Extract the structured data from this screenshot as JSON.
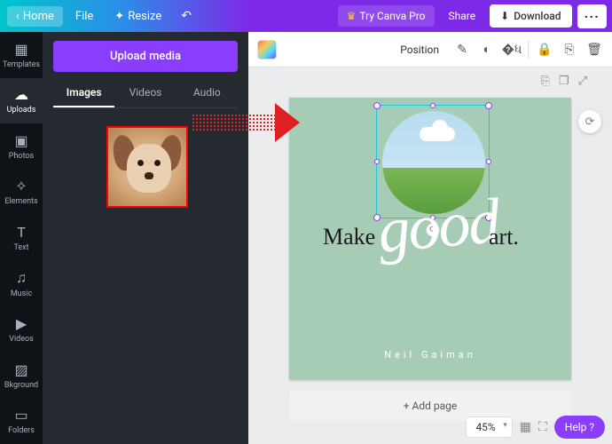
{
  "topbar": {
    "home": "Home",
    "file": "File",
    "resize": "Resize",
    "try_pro": "Try Canva Pro",
    "share": "Share",
    "download": "Download"
  },
  "siderail": {
    "templates": "Templates",
    "uploads": "Uploads",
    "photos": "Photos",
    "elements": "Elements",
    "text": "Text",
    "music": "Music",
    "videos": "Videos",
    "bkground": "Bkground",
    "folders": "Folders"
  },
  "panel": {
    "upload_media": "Upload media",
    "tab_images": "Images",
    "tab_videos": "Videos",
    "tab_audio": "Audio"
  },
  "canvas_toolbar": {
    "position": "Position"
  },
  "artboard": {
    "text_make": "Make",
    "text_good": "good",
    "text_art": "art.",
    "author": "Neil Gaiman",
    "bg_color": "#a7ccb5"
  },
  "page": {
    "add_page": "+ Add page"
  },
  "footer": {
    "zoom": "45%",
    "help": "Help ?"
  }
}
